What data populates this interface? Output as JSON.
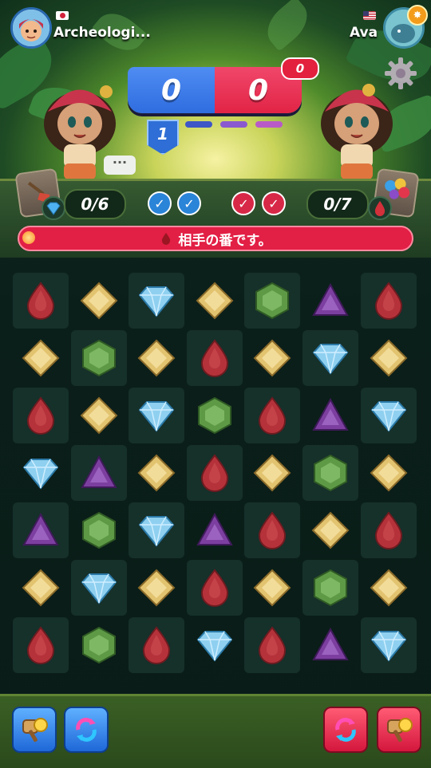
{
  "header": {
    "left_player": {
      "name": "Archeologi...",
      "flag": "jp-flag"
    },
    "right_player": {
      "name": "Ava",
      "flag": "us-flag"
    }
  },
  "score": {
    "left": "0",
    "right": "0",
    "badge": "0"
  },
  "round": {
    "number": "1"
  },
  "goals": {
    "left_counter": "0/6",
    "right_counter": "0/7",
    "left_goal_gem": "blue-diamond",
    "right_goal_gem": "red-drop"
  },
  "turn_message": "相手の番です。",
  "board": {
    "rows": [
      [
        "red",
        "yellow",
        "blue",
        "yellow",
        "green",
        "purple",
        "red"
      ],
      [
        "yellow",
        "green",
        "yellow",
        "red",
        "yellow",
        "blue",
        "yellow"
      ],
      [
        "red",
        "yellow",
        "blue",
        "green",
        "red",
        "purple",
        "blue"
      ],
      [
        "blue",
        "purple",
        "yellow",
        "red",
        "yellow",
        "green",
        "yellow"
      ],
      [
        "purple",
        "green",
        "blue",
        "purple",
        "red",
        "yellow",
        "red"
      ],
      [
        "yellow",
        "blue",
        "yellow",
        "red",
        "yellow",
        "green",
        "yellow"
      ],
      [
        "red",
        "green",
        "red",
        "blue",
        "red",
        "purple",
        "blue"
      ]
    ]
  },
  "colors": {
    "score_blue": "#2f6de0",
    "score_red": "#e22446",
    "turn_bar": "#e21f45",
    "gem_red": "#b5323a",
    "gem_yellow": "#e2c36f",
    "gem_blue": "#8fd0f0",
    "gem_green": "#5e9a46",
    "gem_purple": "#7c3fa0"
  },
  "icons": {
    "settings": "gear-icon",
    "chat": "chat-bubble-icon",
    "left_boosters": [
      "hammer-icon",
      "shuffle-icon"
    ],
    "right_boosters": [
      "shuffle-icon",
      "hammer-icon"
    ]
  }
}
